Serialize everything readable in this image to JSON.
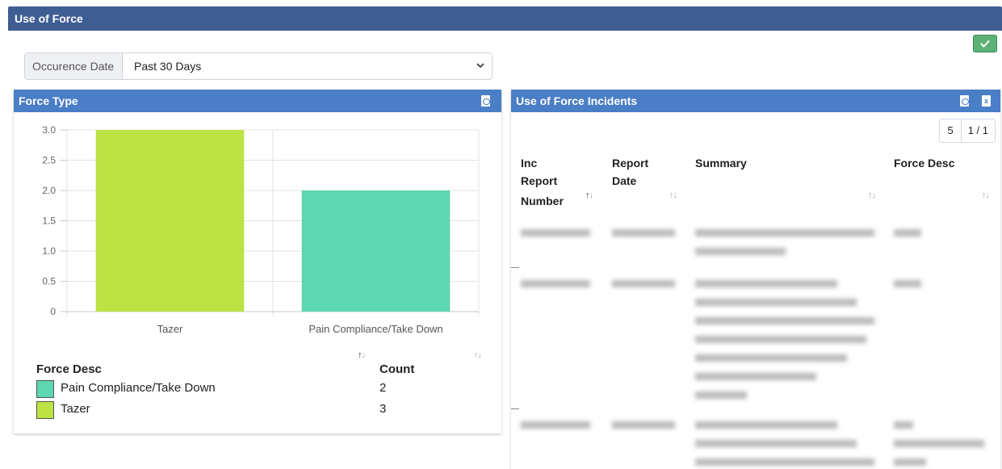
{
  "page": {
    "title": "Use of Force",
    "apply_button_icon": "checkmark-icon"
  },
  "filter": {
    "label": "Occurence Date",
    "value": "Past 30 Days"
  },
  "force_type_panel": {
    "title": "Force Type",
    "legend_headers": {
      "desc": "Force Desc",
      "count": "Count"
    },
    "legend_rows": [
      {
        "desc": "Pain Compliance/Take Down",
        "count": "2",
        "color": "#5dd6b2"
      },
      {
        "desc": "Tazer",
        "count": "3",
        "color": "#bce343"
      }
    ]
  },
  "chart_data": {
    "type": "bar",
    "categories": [
      "Tazer",
      "Pain Compliance/Take Down"
    ],
    "values": [
      3,
      2
    ],
    "colors": [
      "#bce343",
      "#5dd6b2"
    ],
    "ylim": [
      0,
      3
    ],
    "yticks": [
      "0",
      "0.5",
      "1.0",
      "1.5",
      "2.0",
      "2.5",
      "3.0"
    ],
    "grid": true,
    "title": "",
    "xlabel": "",
    "ylabel": ""
  },
  "incidents_panel": {
    "title": "Use of Force Incidents",
    "page_size": "5",
    "page_info": "1 / 1",
    "columns": {
      "inc_line1": "Inc",
      "inc_line2": "Report",
      "inc_line3": "Number",
      "date_line1": "Report",
      "date_line2": "Date",
      "summary": "Summary",
      "force": "Force Desc"
    }
  }
}
